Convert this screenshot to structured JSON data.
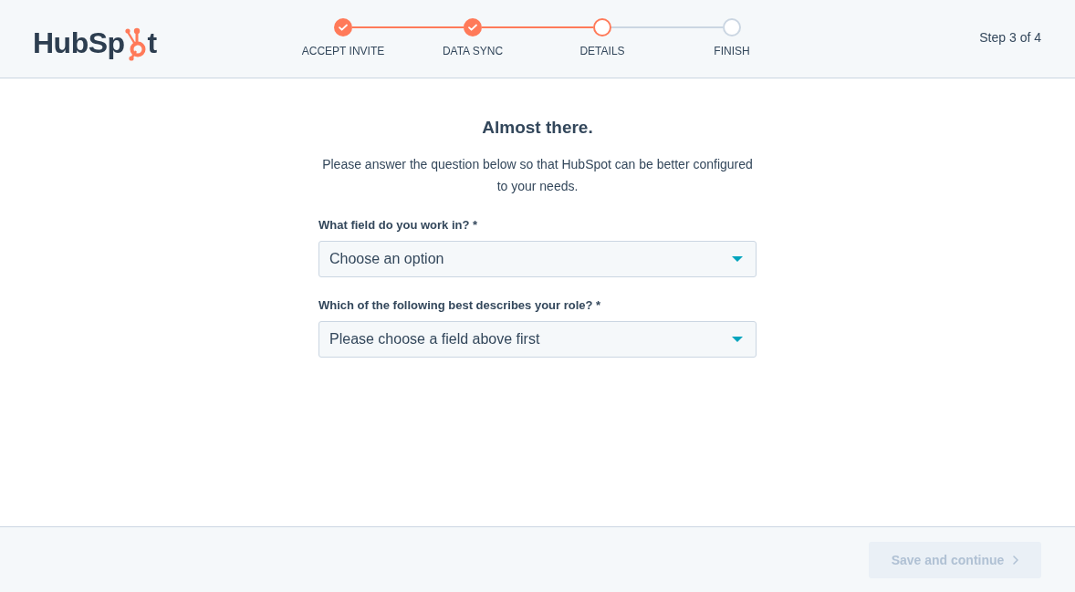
{
  "header": {
    "logo": {
      "text_before_sprocket": "HubSp",
      "text_after_sprocket": "t"
    },
    "steps": [
      {
        "label": "ACCEPT INVITE",
        "kind": "completed"
      },
      {
        "label": "DATA SYNC",
        "kind": "completed"
      },
      {
        "label": "DETAILS",
        "kind": "current"
      },
      {
        "label": "FINISH",
        "kind": "upcoming"
      }
    ],
    "step_counter": "Step 3 of 4"
  },
  "form": {
    "title": "Almost there.",
    "description": "Please answer the question below so that HubSpot can be better configured to your needs.",
    "questions": [
      {
        "label": "What field do you work in? *",
        "value": "Choose an option"
      },
      {
        "label": "Which of the following best describes your role? *",
        "value": "Please choose a field above first"
      }
    ]
  },
  "footer": {
    "button": {
      "label": "Save and continue",
      "disabled": true
    }
  }
}
